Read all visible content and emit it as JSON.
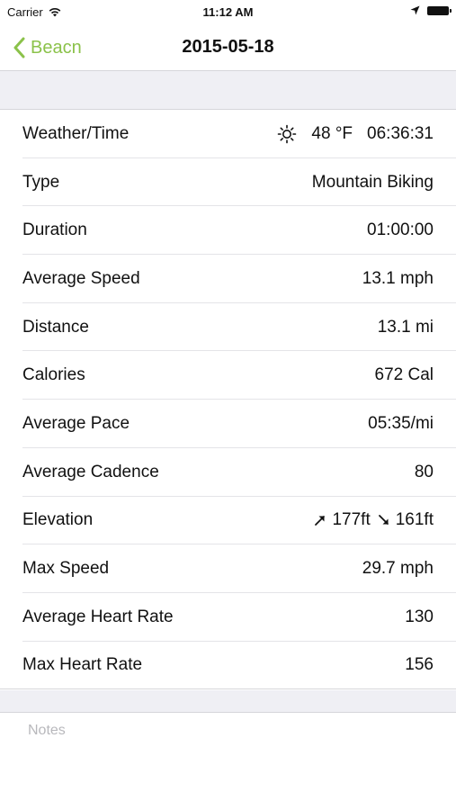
{
  "status_bar": {
    "carrier": "Carrier",
    "time": "11:12 AM"
  },
  "nav": {
    "back_label": "Beacn",
    "title": "2015-05-18",
    "accent_color": "#8bc24a"
  },
  "details": {
    "weather_time": {
      "label": "Weather/Time",
      "weather_icon": "sun-icon",
      "temperature": "48 °F",
      "time": "06:36:31"
    },
    "type": {
      "label": "Type",
      "value": "Mountain Biking"
    },
    "duration": {
      "label": "Duration",
      "value": "01:00:00"
    },
    "average_speed": {
      "label": "Average Speed",
      "value": "13.1 mph"
    },
    "distance": {
      "label": "Distance",
      "value": "13.1 mi"
    },
    "calories": {
      "label": "Calories",
      "value": "672 Cal"
    },
    "average_pace": {
      "label": "Average Pace",
      "value": "05:35/mi"
    },
    "average_cadence": {
      "label": "Average Cadence",
      "value": "80"
    },
    "elevation": {
      "label": "Elevation",
      "gain": "177ft",
      "loss": "161ft",
      "gain_icon": "arrow-up-right-icon",
      "loss_icon": "arrow-down-right-icon"
    },
    "max_speed": {
      "label": "Max Speed",
      "value": "29.7 mph"
    },
    "average_heart_rate": {
      "label": "Average Heart Rate",
      "value": "130"
    },
    "max_heart_rate": {
      "label": "Max Heart Rate",
      "value": "156"
    }
  },
  "notes": {
    "placeholder": "Notes"
  }
}
